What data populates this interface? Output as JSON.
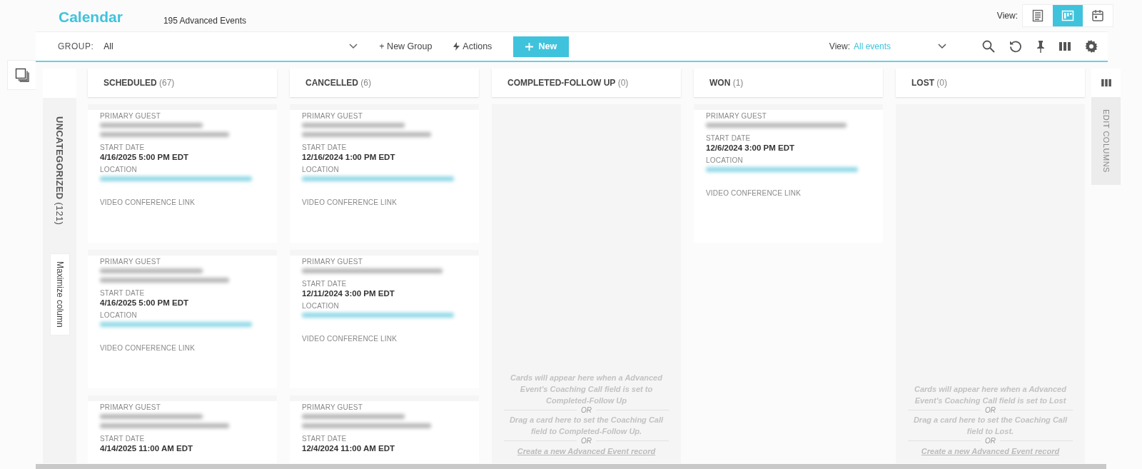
{
  "header": {
    "title": "Calendar",
    "count": "195 Advanced Events",
    "view_label": "View:",
    "views": [
      {
        "kind": "list",
        "selected": false
      },
      {
        "kind": "board",
        "selected": true
      },
      {
        "kind": "calendar",
        "selected": false
      }
    ]
  },
  "toolbar": {
    "group_label": "GROUP:",
    "group_value": "All",
    "new_group": "+ New Group",
    "actions": "Actions",
    "new": "New",
    "view_label": "View:",
    "view_value": "All events"
  },
  "lane": {
    "title": "UNCATEGORIZED",
    "count": "(121)",
    "maximize": "Maximize column"
  },
  "edit_columns": "EDIT COLUMNS",
  "columns": [
    {
      "title": "SCHEDULED",
      "count": "(67)",
      "cards": [
        {
          "fields": [
            {
              "kind": "label",
              "text": "PRIMARY GUEST"
            },
            {
              "kind": "blurred",
              "wrap": true
            },
            {
              "kind": "label",
              "text": "START DATE"
            },
            {
              "kind": "value",
              "text": "4/16/2025 5:00 PM EDT"
            },
            {
              "kind": "label",
              "text": "LOCATION"
            },
            {
              "kind": "blurred-link",
              "wrap": false
            },
            {
              "kind": "label",
              "text": "VIDEO CONFERENCE LINK"
            }
          ]
        },
        {
          "fields": [
            {
              "kind": "label",
              "text": "PRIMARY GUEST"
            },
            {
              "kind": "blurred",
              "wrap": true
            },
            {
              "kind": "label",
              "text": "START DATE"
            },
            {
              "kind": "value",
              "text": "4/16/2025 5:00 PM EDT"
            },
            {
              "kind": "label",
              "text": "LOCATION"
            },
            {
              "kind": "blurred-link",
              "wrap": false
            },
            {
              "kind": "label",
              "text": "VIDEO CONFERENCE LINK"
            }
          ]
        },
        {
          "fields": [
            {
              "kind": "label",
              "text": "PRIMARY GUEST"
            },
            {
              "kind": "blurred",
              "wrap": true
            },
            {
              "kind": "label",
              "text": "START DATE"
            },
            {
              "kind": "value",
              "text": "4/14/2025 11:00 AM EDT"
            }
          ]
        }
      ]
    },
    {
      "title": "CANCELLED",
      "count": "(6)",
      "cards": [
        {
          "fields": [
            {
              "kind": "label",
              "text": "PRIMARY GUEST"
            },
            {
              "kind": "blurred",
              "wrap": true
            },
            {
              "kind": "label",
              "text": "START DATE"
            },
            {
              "kind": "value",
              "text": "12/16/2024 1:00 PM EDT"
            },
            {
              "kind": "label",
              "text": "LOCATION"
            },
            {
              "kind": "blurred-link",
              "wrap": false
            },
            {
              "kind": "label",
              "text": "VIDEO CONFERENCE LINK"
            }
          ]
        },
        {
          "fields": [
            {
              "kind": "label",
              "text": "PRIMARY GUEST"
            },
            {
              "kind": "blurred",
              "wrap": false
            },
            {
              "kind": "label",
              "text": "START DATE"
            },
            {
              "kind": "value",
              "text": "12/11/2024 3:00 PM EDT"
            },
            {
              "kind": "label",
              "text": "LOCATION"
            },
            {
              "kind": "blurred-link",
              "wrap": false
            },
            {
              "kind": "label",
              "text": "VIDEO CONFERENCE LINK"
            }
          ]
        },
        {
          "fields": [
            {
              "kind": "label",
              "text": "PRIMARY GUEST"
            },
            {
              "kind": "blurred",
              "wrap": true
            },
            {
              "kind": "label",
              "text": "START DATE"
            },
            {
              "kind": "value",
              "text": "12/4/2024 11:00 AM EDT"
            }
          ]
        }
      ]
    },
    {
      "title": "COMPLETED-FOLLOW UP",
      "count": "(0)",
      "empty": [
        {
          "kind": "text",
          "text": "Cards will appear here when a Advanced Event's Coaching Call field is set to Completed-Follow Up"
        },
        {
          "kind": "or",
          "text": "OR"
        },
        {
          "kind": "text",
          "text": "Drag a card here to set the Coaching Call field to Completed-Follow Up."
        },
        {
          "kind": "or",
          "text": "OR"
        },
        {
          "kind": "link",
          "text": "Create a new Advanced Event record"
        }
      ]
    },
    {
      "title": "WON",
      "count": "(1)",
      "cards": [
        {
          "fields": [
            {
              "kind": "label",
              "text": "PRIMARY GUEST"
            },
            {
              "kind": "blurred",
              "wrap": false
            },
            {
              "kind": "label",
              "text": "START DATE"
            },
            {
              "kind": "value",
              "text": "12/6/2024 3:00 PM EDT"
            },
            {
              "kind": "label",
              "text": "LOCATION"
            },
            {
              "kind": "blurred-link",
              "wrap": false
            },
            {
              "kind": "label",
              "text": "VIDEO CONFERENCE LINK"
            }
          ]
        }
      ]
    },
    {
      "title": "LOST",
      "count": "(0)",
      "empty": [
        {
          "kind": "text",
          "text": "Cards will appear here when a Advanced Event's Coaching Call field is set to Lost"
        },
        {
          "kind": "or",
          "text": "OR"
        },
        {
          "kind": "text",
          "text": "Drag a card here to set the Coaching Call field to Lost."
        },
        {
          "kind": "or",
          "text": "OR"
        },
        {
          "kind": "link",
          "text": "Create a new Advanced Event record"
        }
      ]
    }
  ]
}
